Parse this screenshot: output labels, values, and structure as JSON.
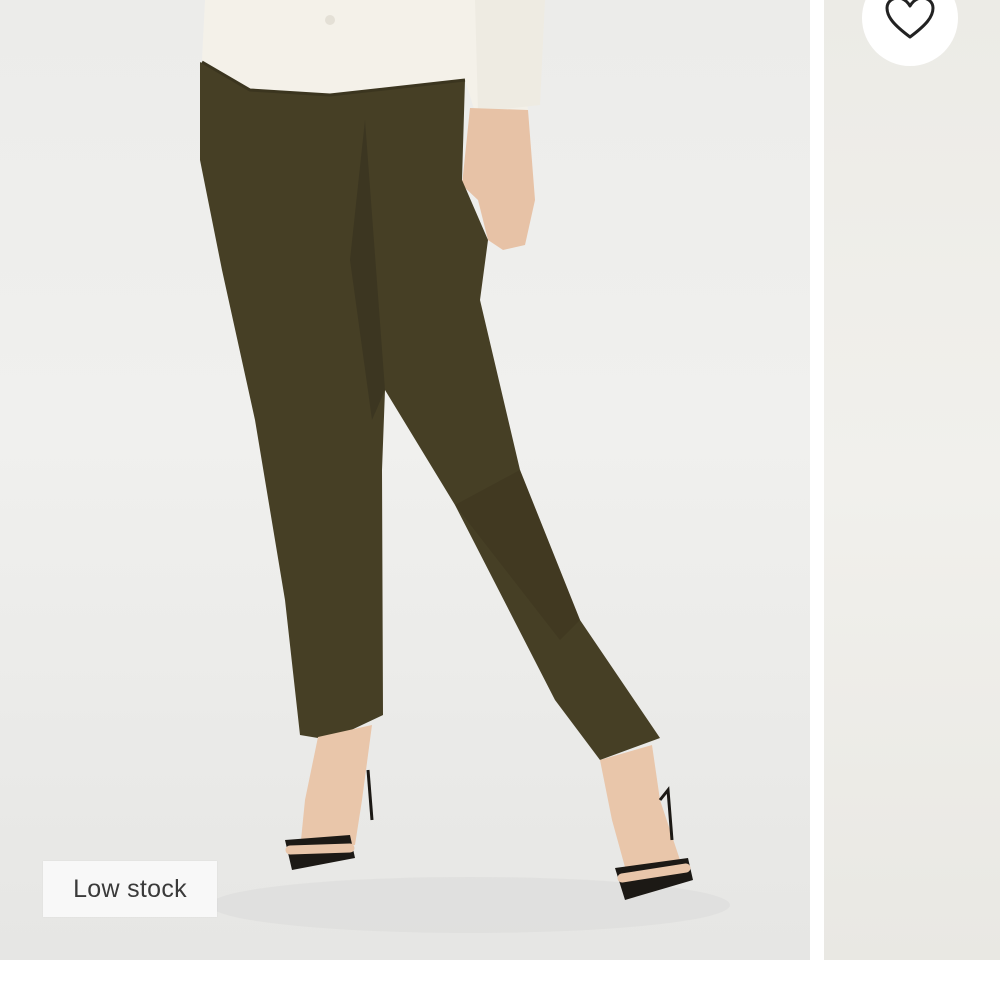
{
  "product_gallery": {
    "stock_badge": "Low stock",
    "wishlist_icon": "heart-outline-icon",
    "colors": {
      "trousers": "#463f25",
      "shirt": "#f2efe7",
      "badge_text": "#3a3a3a"
    }
  }
}
